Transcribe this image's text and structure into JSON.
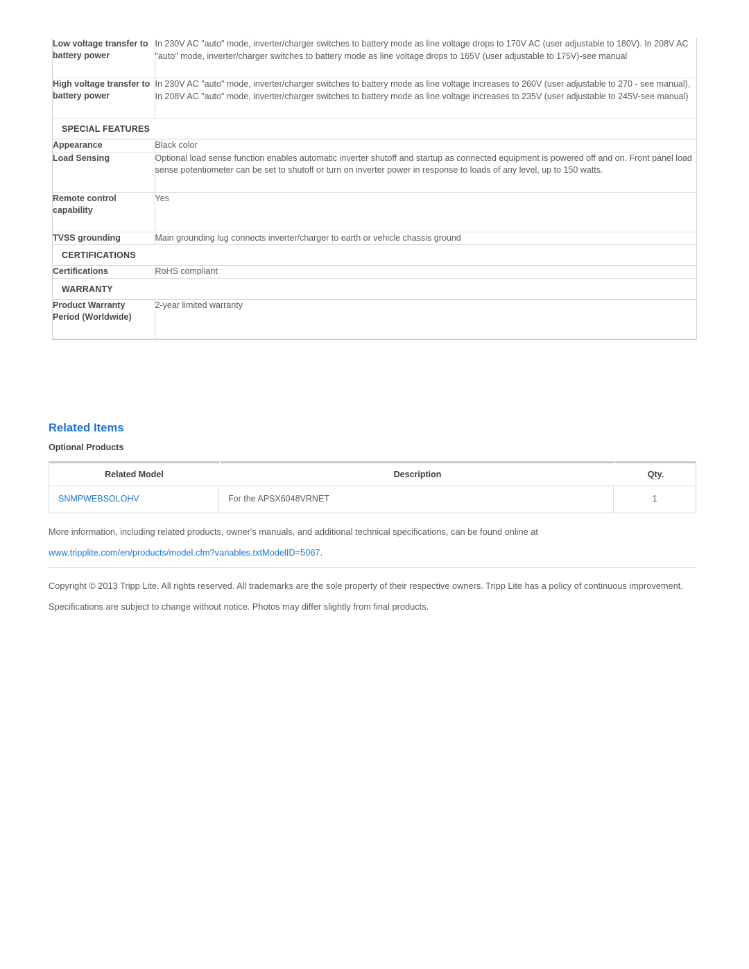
{
  "spec_table": {
    "rows": [
      {
        "type": "data",
        "label": "Low voltage transfer to battery power",
        "value": "In 230V AC \"auto\" mode, inverter/charger switches to battery mode as line voltage drops to 170V AC (user adjustable to 180V). In 208V AC \"auto\" mode, inverter/charger switches to battery mode as line voltage drops to 165V (user adjustable to 175V)-see manual"
      },
      {
        "type": "data",
        "label": "High voltage transfer to battery power",
        "value": "In 230V AC \"auto\" mode, inverter/charger switches to battery mode as line voltage increases to 260V (user adjustable to 270 - see manual), In 208V AC \"auto\" mode, inverter/charger switches to battery mode as line voltage increases to 235V (user adjustable to 245V-see manual)"
      },
      {
        "type": "section",
        "label": "SPECIAL FEATURES"
      },
      {
        "type": "data",
        "label": "Appearance",
        "value": "Black color"
      },
      {
        "type": "data",
        "label": "Load Sensing",
        "value": "Optional load sense function enables automatic inverter shutoff and startup as connected equipment is powered off and on. Front panel load sense potentiometer can be set to shutoff or turn on inverter power in response to loads of any level, up to 150 watts."
      },
      {
        "type": "data",
        "label": "Remote control capability",
        "value": "Yes"
      },
      {
        "type": "data",
        "label": "TVSS grounding",
        "value": "Main grounding lug connects inverter/charger to earth or vehicle chassis ground"
      },
      {
        "type": "section",
        "label": "CERTIFICATIONS"
      },
      {
        "type": "data",
        "label": "Certifications",
        "value": "RoHS compliant"
      },
      {
        "type": "section",
        "label": "WARRANTY"
      },
      {
        "type": "data",
        "label": "Product Warranty Period (Worldwide)",
        "value": "2-year limited warranty"
      }
    ]
  },
  "related": {
    "heading": "Related Items",
    "subheading": "Optional Products",
    "columns": [
      "Related Model",
      "Description",
      "Qty."
    ],
    "rows": [
      {
        "model": "SNMPWEBSOLOHV",
        "description": "For the APSX6048VRNET",
        "qty": "1"
      }
    ]
  },
  "footer": {
    "more_info_text": "More information, including related products, owner's manuals, and additional technical specifications, can be found online at",
    "url": "www.tripplite.com/en/products/model.cfm?variables.txtModelID=5067",
    "url_period": ".",
    "copyright": "Copyright © 2013 Tripp Lite. All rights reserved. All trademarks are the sole property of their respective owners. Tripp Lite has a policy of continuous improvement. Specifications are subject to change without notice. Photos may differ slightly from final products."
  },
  "colors": {
    "link": "#1b75cf",
    "heading": "#1b75cf",
    "label_text": "#4a4a4a",
    "value_text": "#5a5a5a",
    "border": "#d9d9d9"
  }
}
